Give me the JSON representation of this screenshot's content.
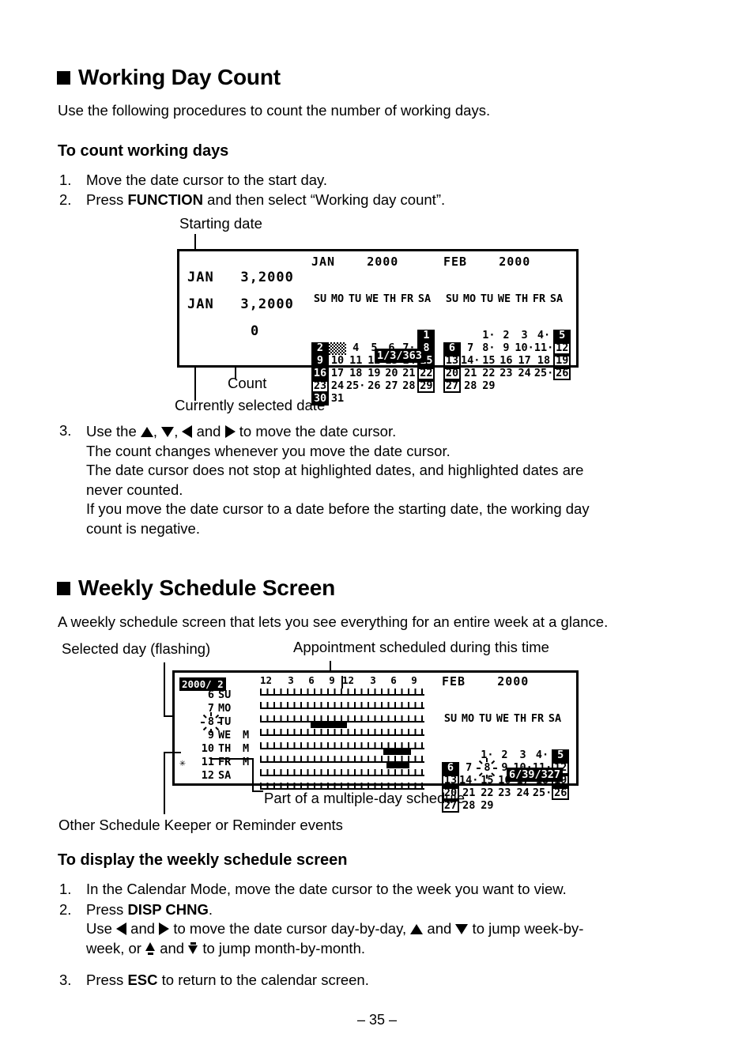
{
  "page": {
    "number_label": "– 35 –"
  },
  "section1": {
    "heading": "Working Day Count",
    "intro": "Use the following procedures to count the number of working days.",
    "subheading": "To count working days",
    "steps": [
      {
        "num": "1.",
        "text": "Move the date cursor to the start day."
      },
      {
        "num": "2.",
        "pre": "Press ",
        "bold": "FUNCTION",
        "post": " and then select “Working day count”."
      }
    ],
    "callouts": {
      "starting_date": "Starting date",
      "count": "Count",
      "currently_selected_date": "Currently selected date"
    },
    "step3": {
      "num": "3.",
      "line1_a": "Use the ",
      "line1_b": ", ",
      "line1_c": ", ",
      "line1_d": " and ",
      "line1_e": " to move the date cursor.",
      "line2": "The count changes whenever you move the date cursor.",
      "line3": "The date cursor does not stop at highlighted dates, and highlighted dates are",
      "line4": "never counted.",
      "line5": "If you move the date cursor to a date before the starting date, the working day",
      "line6": "count is negative."
    }
  },
  "lcd1": {
    "start_date_line": "JAN   3,2000",
    "current_date_line": "JAN   3,2000",
    "count_value": "0",
    "status": "1/3/363",
    "jan": {
      "title": "JAN    2000",
      "dow": [
        "SU",
        "MO",
        "TU",
        "WE",
        "TH",
        "FR",
        "SA"
      ],
      "weeks": [
        [
          {
            "d": ""
          },
          {
            "d": ""
          },
          {
            "d": ""
          },
          {
            "d": ""
          },
          {
            "d": ""
          },
          {
            "d": ""
          },
          {
            "d": "1",
            "style": "inv"
          }
        ],
        [
          {
            "d": "2",
            "style": "inv"
          },
          {
            "d": "3",
            "style": "cursor"
          },
          {
            "d": "4"
          },
          {
            "d": "5"
          },
          {
            "d": "6"
          },
          {
            "d": "7",
            "dot": true
          },
          {
            "d": "8",
            "style": "inv"
          }
        ],
        [
          {
            "d": "9",
            "style": "inv"
          },
          {
            "d": "10"
          },
          {
            "d": "11"
          },
          {
            "d": "12"
          },
          {
            "d": "13"
          },
          {
            "d": "14"
          },
          {
            "d": "15",
            "style": "inv"
          }
        ],
        [
          {
            "d": "16",
            "style": "inv"
          },
          {
            "d": "17"
          },
          {
            "d": "18"
          },
          {
            "d": "19"
          },
          {
            "d": "20"
          },
          {
            "d": "21"
          },
          {
            "d": "22",
            "style": "box"
          }
        ],
        [
          {
            "d": "23",
            "style": "box"
          },
          {
            "d": "24"
          },
          {
            "d": "25",
            "dot": true
          },
          {
            "d": "26"
          },
          {
            "d": "27"
          },
          {
            "d": "28"
          },
          {
            "d": "29",
            "style": "box"
          }
        ],
        [
          {
            "d": "30",
            "style": "inv"
          },
          {
            "d": "31"
          },
          {
            "d": ""
          },
          {
            "d": ""
          },
          {
            "d": ""
          },
          {
            "d": ""
          },
          {
            "d": ""
          }
        ]
      ]
    },
    "feb": {
      "title": "FEB    2000",
      "dow": [
        "SU",
        "MO",
        "TU",
        "WE",
        "TH",
        "FR",
        "SA"
      ],
      "weeks": [
        [
          {
            "d": ""
          },
          {
            "d": ""
          },
          {
            "d": "1",
            "dot": true
          },
          {
            "d": "2"
          },
          {
            "d": "3"
          },
          {
            "d": "4",
            "dot": true
          },
          {
            "d": "5",
            "style": "inv"
          }
        ],
        [
          {
            "d": "6",
            "style": "inv"
          },
          {
            "d": "7"
          },
          {
            "d": "8",
            "dot": true
          },
          {
            "d": "9"
          },
          {
            "d": "10",
            "dot": true
          },
          {
            "d": "11",
            "dot": true
          },
          {
            "d": "12",
            "style": "box"
          }
        ],
        [
          {
            "d": "13",
            "style": "box"
          },
          {
            "d": "14",
            "dot": true
          },
          {
            "d": "15"
          },
          {
            "d": "16"
          },
          {
            "d": "17"
          },
          {
            "d": "18"
          },
          {
            "d": "19",
            "style": "box"
          }
        ],
        [
          {
            "d": "20",
            "style": "box"
          },
          {
            "d": "21"
          },
          {
            "d": "22"
          },
          {
            "d": "23"
          },
          {
            "d": "24"
          },
          {
            "d": "25",
            "dot": true
          },
          {
            "d": "26",
            "style": "box"
          }
        ],
        [
          {
            "d": "27",
            "style": "box"
          },
          {
            "d": "28"
          },
          {
            "d": "29"
          },
          {
            "d": ""
          },
          {
            "d": ""
          },
          {
            "d": ""
          },
          {
            "d": ""
          }
        ]
      ]
    }
  },
  "section2": {
    "heading": "Weekly Schedule Screen",
    "intro": "A weekly schedule screen that lets you see everything for an entire week at a glance.",
    "callouts": {
      "selected_day": "Selected day (flashing)",
      "appointment": "Appointment scheduled during this time",
      "multiday": "Part of a multiple-day schedule",
      "other_events": "Other Schedule Keeper or Reminder events"
    },
    "subheading": "To display the weekly schedule screen",
    "steps": [
      {
        "num": "1.",
        "text": "In the Calendar Mode, move the date cursor to the week you want to view."
      },
      {
        "num": "2.",
        "pre": "Press ",
        "bold": "DISP CHNG",
        "post": "."
      },
      {
        "num": "3.",
        "pre": "Press ",
        "bold": "ESC",
        "post": " to return to the calendar screen."
      }
    ],
    "step2_detail": {
      "a": "Use ",
      "b": " and ",
      "c": " to move the date cursor day-by-day, ",
      "d": " and ",
      "e": " to jump week-by-",
      "f": "week, or ",
      "g": " and ",
      "h": " to jump month-by-month."
    }
  },
  "lcd2": {
    "header_inverted": "2000/ 2",
    "time_scale": [
      "12",
      "3",
      "6",
      "9",
      "12",
      "3",
      "6",
      "9"
    ],
    "days": [
      {
        "date": "6",
        "dow": "SU",
        "mark": "",
        "star": false,
        "flash": false,
        "bar": null
      },
      {
        "date": "7",
        "dow": "MO",
        "mark": "",
        "star": false,
        "flash": false,
        "bar": null
      },
      {
        "date": "8",
        "dow": "TU",
        "mark": "",
        "star": false,
        "flash": true,
        "bar": {
          "start": 31,
          "width": 22
        }
      },
      {
        "date": "9",
        "dow": "WE",
        "mark": "M",
        "star": false,
        "flash": false,
        "bar": null
      },
      {
        "date": "10",
        "dow": "TH",
        "mark": "M",
        "star": false,
        "flash": false,
        "bar": {
          "start": 75,
          "width": 17
        }
      },
      {
        "date": "11",
        "dow": "FR",
        "mark": "M",
        "star": true,
        "flash": false,
        "bar": {
          "start": 77,
          "width": 14
        }
      },
      {
        "date": "12",
        "dow": "SA",
        "mark": "",
        "star": false,
        "flash": false,
        "bar": null
      }
    ],
    "status": "6/39/327",
    "feb": {
      "title": "FEB    2000",
      "dow": [
        "SU",
        "MO",
        "TU",
        "WE",
        "TH",
        "FR",
        "SA"
      ],
      "weeks": [
        [
          {
            "d": ""
          },
          {
            "d": ""
          },
          {
            "d": "1",
            "dot": true
          },
          {
            "d": "2"
          },
          {
            "d": "3"
          },
          {
            "d": "4",
            "dot": true
          },
          {
            "d": "5",
            "style": "inv"
          }
        ],
        [
          {
            "d": "6",
            "style": "inv"
          },
          {
            "d": "7"
          },
          {
            "d": "8",
            "flash": true
          },
          {
            "d": "9"
          },
          {
            "d": "10",
            "dot": true
          },
          {
            "d": "11",
            "dot": true
          },
          {
            "d": "12",
            "style": "box"
          }
        ],
        [
          {
            "d": "13",
            "style": "box"
          },
          {
            "d": "14",
            "dot": true
          },
          {
            "d": "15"
          },
          {
            "d": "16"
          },
          {
            "d": "17"
          },
          {
            "d": "18"
          },
          {
            "d": "19",
            "style": "box"
          }
        ],
        [
          {
            "d": "20",
            "style": "box"
          },
          {
            "d": "21"
          },
          {
            "d": "22"
          },
          {
            "d": "23"
          },
          {
            "d": "24"
          },
          {
            "d": "25",
            "dot": true
          },
          {
            "d": "26",
            "style": "box"
          }
        ],
        [
          {
            "d": "27",
            "style": "box"
          },
          {
            "d": "28"
          },
          {
            "d": "29"
          },
          {
            "d": ""
          },
          {
            "d": ""
          },
          {
            "d": ""
          },
          {
            "d": ""
          }
        ]
      ]
    }
  }
}
